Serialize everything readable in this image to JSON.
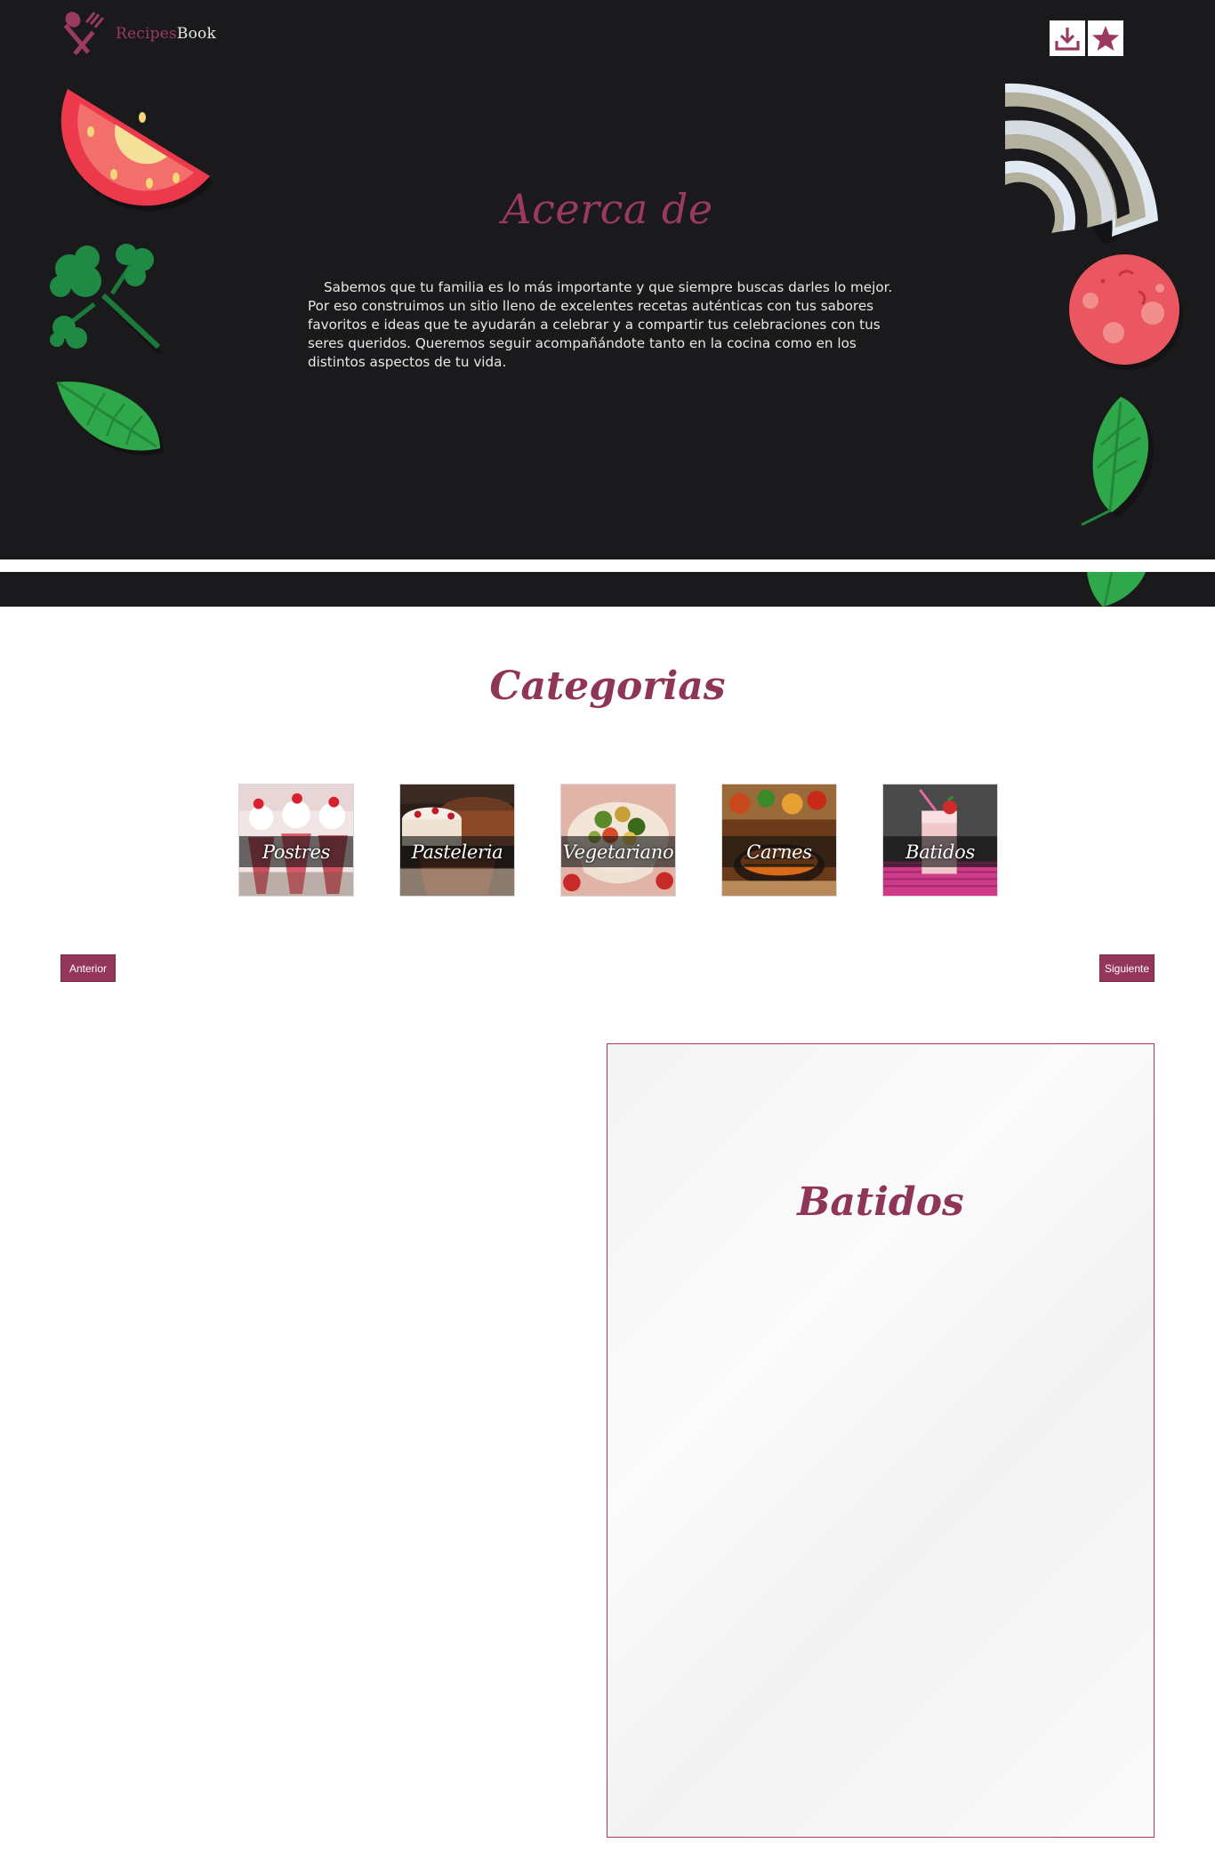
{
  "brand": {
    "name_part1": "Recipes",
    "name_part2": "Book"
  },
  "header_buttons": [
    {
      "icon": "download-icon"
    },
    {
      "icon": "star-icon"
    }
  ],
  "about": {
    "title": "Acerca de",
    "text": "Sabemos que tu familia es lo más importante y que siempre buscas darles lo mejor. Por eso construimos un sitio lleno de excelentes recetas auténticas con tus sabores favoritos e ideas que te ayudarán a celebrar y a compartir tus celebraciones con tus seres queridos. Queremos seguir acompañándote tanto en la cocina como en los distintos aspectos de tu vida."
  },
  "categories": {
    "title": "Categorias",
    "items": [
      {
        "label": "Postres"
      },
      {
        "label": "Pasteleria"
      },
      {
        "label": "Vegetariano"
      },
      {
        "label": "Carnes"
      },
      {
        "label": "Batidos"
      }
    ]
  },
  "pager": {
    "prev_label": "Anterior",
    "next_label": "Siguiente"
  },
  "detail": {
    "title": "Batidos"
  },
  "colors": {
    "brand": "#93365a",
    "hero_bg": "#1a1a1c",
    "tomato": "#ec3a4c",
    "leaf": "#2ea84a"
  }
}
